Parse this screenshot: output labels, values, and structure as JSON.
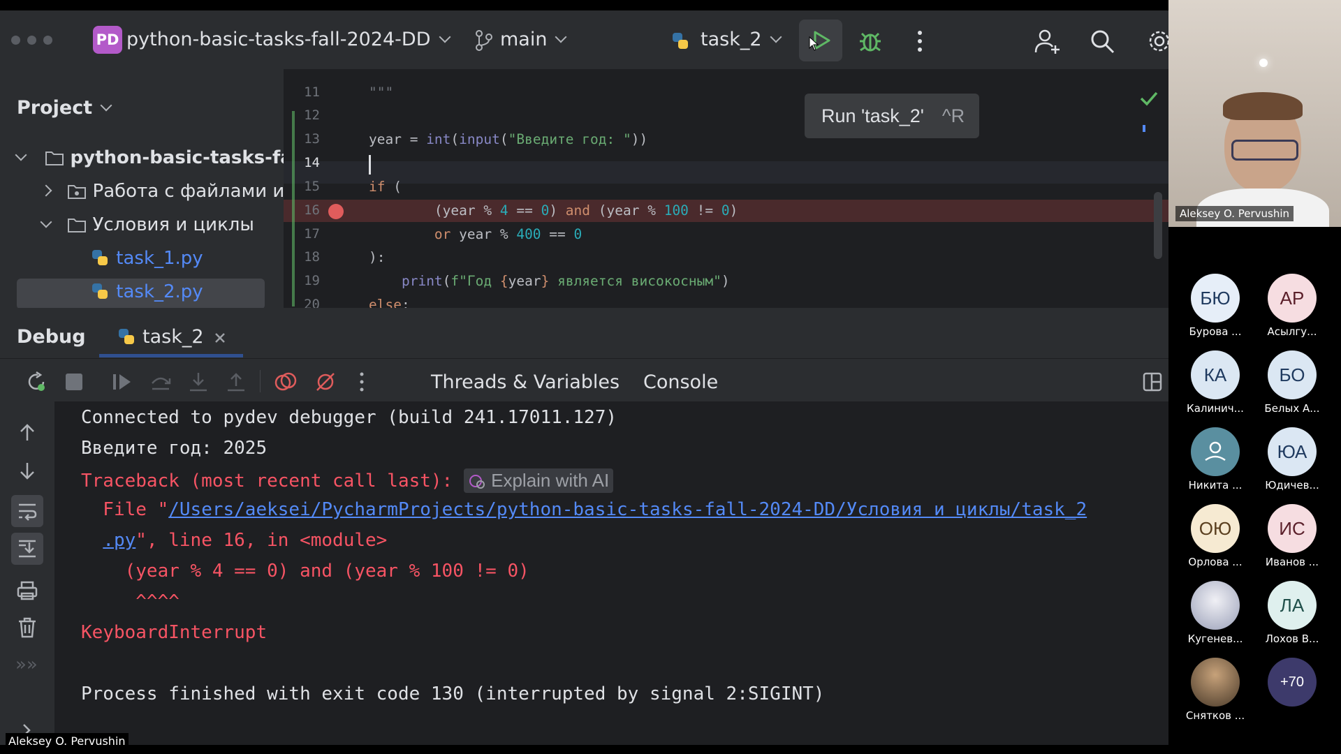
{
  "toolbar": {
    "project_badge": "PD",
    "project_name": "python-basic-tasks-fall-2024-DD",
    "branch": "main",
    "run_config": "task_2"
  },
  "tooltip": {
    "label": "Run 'task_2'",
    "shortcut": "^R"
  },
  "sidebar": {
    "title": "Project",
    "root": "python-basic-tasks-fall-",
    "folder1": "Работа с файлами и м",
    "folder2": "Условия и циклы",
    "file1": "task_1.py",
    "file2": "task_2.py"
  },
  "editor": {
    "line_numbers": [
      "11",
      "12",
      "13",
      "14",
      "15",
      "16",
      "17",
      "18",
      "19",
      "20"
    ]
  },
  "debug": {
    "title": "Debug",
    "tab": "task_2",
    "tabs": [
      "Threads & Variables",
      "Console"
    ]
  },
  "console": {
    "line1": "Connected to pydev debugger (build 241.17011.127)",
    "line2": "Введите год: 2025",
    "line3": "Traceback (most recent call last):",
    "ai_chip": "Explain with AI",
    "file_prefix": "  File \"",
    "file_path": "/Users/aeksei/PycharmProjects/python-basic-tasks-fall-2024-DD/Условия и циклы/task_2",
    "file_path2": ".py",
    "file_suffix": "\", line 16, in <module>",
    "code_line": "    (year % 4 == 0) and (year % 100 != 0)",
    "caret": "     ^^^^",
    "interrupt": "KeyboardInterrupt",
    "finish": "Process finished with exit code 130 (interrupted by signal 2:SIGINT)"
  },
  "zoom": {
    "speaker": "Aleksey O. Pervushin",
    "participants": [
      {
        "initials": "БЮ",
        "name": "Бурова ...",
        "color": "#e6eef8",
        "text": "#1f3a5f"
      },
      {
        "initials": "АР",
        "name": "Асылгу...",
        "color": "#f6dde1",
        "text": "#5a1f2a"
      },
      {
        "initials": "КА",
        "name": "Калинич...",
        "color": "#dbe7f3",
        "text": "#1f3a5f"
      },
      {
        "initials": "БО",
        "name": "Белых А...",
        "color": "#dbe7f3",
        "text": "#1f3a5f"
      },
      {
        "initials": "",
        "name": "Никита ...",
        "color": "#5a8fa0",
        "text": "#ffffff"
      },
      {
        "initials": "ЮА",
        "name": "Юдичев...",
        "color": "#dbe7f3",
        "text": "#1f3a5f"
      },
      {
        "initials": "ОЮ",
        "name": "Орлова ...",
        "color": "#f6ead2",
        "text": "#5a3f1f"
      },
      {
        "initials": "ИС",
        "name": "Иванов ...",
        "color": "#f6dde1",
        "text": "#5a1f2a"
      },
      {
        "initials": "",
        "name": "Кугенев...",
        "color": "#c7c9d3",
        "text": "#ffffff"
      },
      {
        "initials": "ЛА",
        "name": "Лохов В...",
        "color": "#dff0ee",
        "text": "#1f4f4a"
      },
      {
        "initials": "",
        "name": "Сняткoв ...",
        "color": "#7a6650",
        "text": "#ffffff"
      },
      {
        "initials": "+70",
        "name": "",
        "color": "#3d3a6b",
        "text": "#ffffff"
      }
    ],
    "bottom_name": "Aleksey O. Pervushin"
  }
}
